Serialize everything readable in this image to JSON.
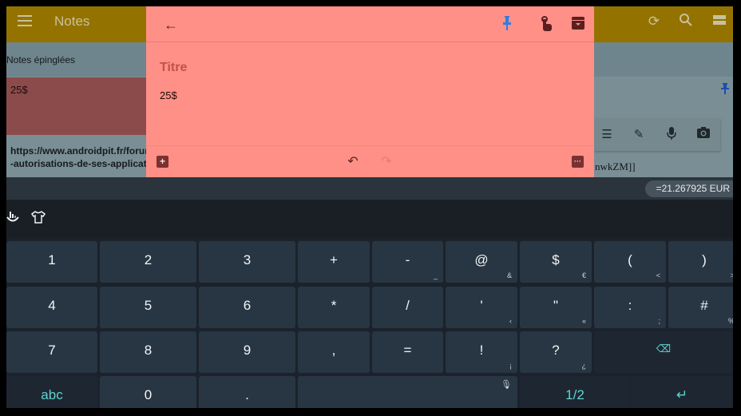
{
  "app": {
    "title": "Notes",
    "icons": {
      "menu": "hamburger-menu-icon",
      "refresh": "refresh-icon",
      "search": "search-icon",
      "view": "view-toggle-icon"
    }
  },
  "list": {
    "section_label": "Notes épinglées",
    "notes": [
      {
        "text": "25$",
        "color": "#8c4b4b"
      },
      {
        "text": "https://www.androidpit.fr/forum\n-autorisations-de-ses-applicati"
      }
    ],
    "right_text": "nwkZM]]"
  },
  "quick_toolbar": {
    "icons": [
      "checklist-icon",
      "pencil-icon",
      "microphone-icon",
      "camera-icon"
    ]
  },
  "editor": {
    "background": "#ff9088",
    "title_placeholder": "Titre",
    "body": "25$",
    "top_icons": [
      "back-arrow-icon",
      "pin-icon",
      "reminder-icon",
      "archive-icon"
    ],
    "bottom_icons": [
      "add-icon",
      "undo-icon",
      "redo-icon",
      "more-icon"
    ]
  },
  "keyboard": {
    "suggestion": "=21.267925 EUR",
    "toolbar_icons": [
      "swiftkey-logo-icon",
      "theme-shirt-icon"
    ],
    "rows": [
      [
        {
          "main": "1"
        },
        {
          "main": "2"
        },
        {
          "main": "3"
        },
        {
          "main": "+"
        },
        {
          "main": "-",
          "sub": "_"
        },
        {
          "main": "@",
          "sub": "&"
        },
        {
          "main": "$",
          "sub": "€"
        },
        {
          "main": "(",
          "sub": "<"
        },
        {
          "main": ")",
          "sub": ">"
        }
      ],
      [
        {
          "main": "4"
        },
        {
          "main": "5"
        },
        {
          "main": "6"
        },
        {
          "main": "*"
        },
        {
          "main": "/"
        },
        {
          "main": "'",
          "sub": "‹"
        },
        {
          "main": "\"",
          "sub": "«"
        },
        {
          "main": ":",
          "sub": ";"
        },
        {
          "main": "#",
          "sub": "%"
        }
      ],
      [
        {
          "main": "7"
        },
        {
          "main": "8"
        },
        {
          "main": "9"
        },
        {
          "main": ","
        },
        {
          "main": "="
        },
        {
          "main": "!",
          "sub": "¡"
        },
        {
          "main": "?",
          "sub": "¿"
        },
        {
          "main": "⌫",
          "name": "backspace"
        }
      ],
      [
        {
          "main": "abc",
          "name": "abc"
        },
        {
          "main": "0"
        },
        {
          "main": "."
        },
        {
          "main": "",
          "name": "space"
        },
        {
          "main": "1/2",
          "name": "page"
        },
        {
          "main": "↵",
          "name": "enter"
        }
      ]
    ],
    "accent_color": "#5fd3d3"
  }
}
